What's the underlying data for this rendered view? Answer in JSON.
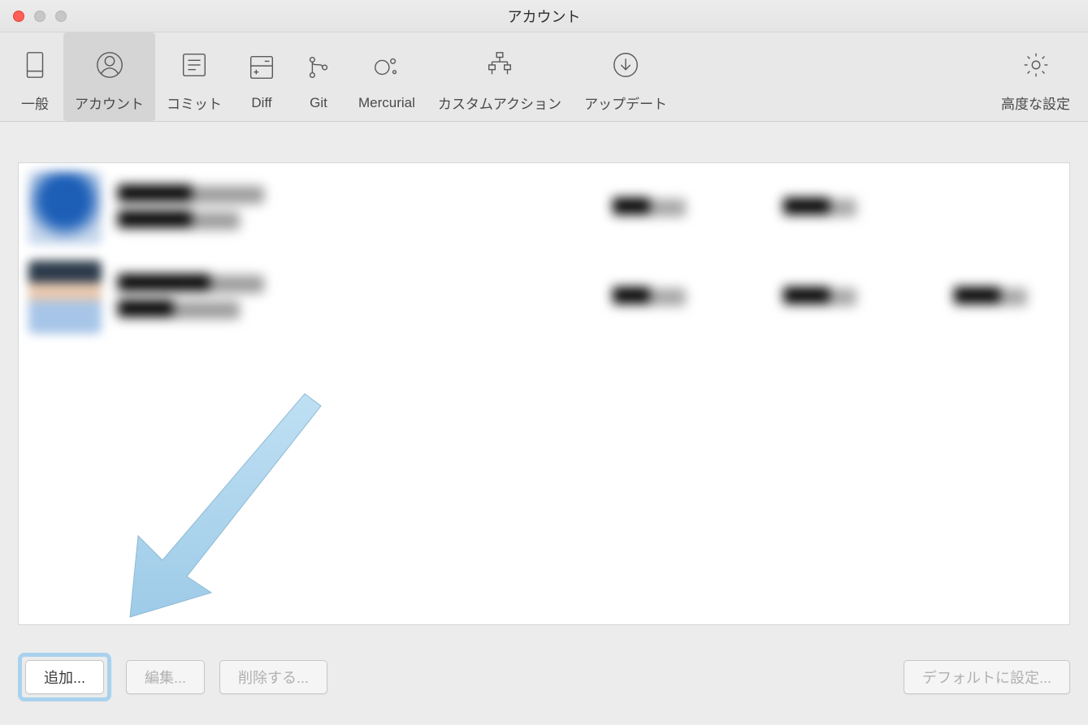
{
  "window": {
    "title": "アカウント"
  },
  "toolbar": {
    "general": "一般",
    "accounts": "アカウント",
    "commit": "コミット",
    "diff": "Diff",
    "git": "Git",
    "mercurial": "Mercurial",
    "custom_actions": "カスタムアクション",
    "update": "アップデート",
    "advanced": "高度な設定"
  },
  "accounts": {
    "rows": [
      {
        "name_primary": "████████",
        "name_secondary": "████████",
        "col1": "████",
        "col2": "█████",
        "col3": ""
      },
      {
        "name_primary": "██████████",
        "name_secondary": "██████",
        "col1": "████",
        "col2": "█████",
        "col3": "█████"
      }
    ]
  },
  "buttons": {
    "add": "追加...",
    "edit": "編集...",
    "delete": "削除する...",
    "set_default": "デフォルトに設定..."
  }
}
